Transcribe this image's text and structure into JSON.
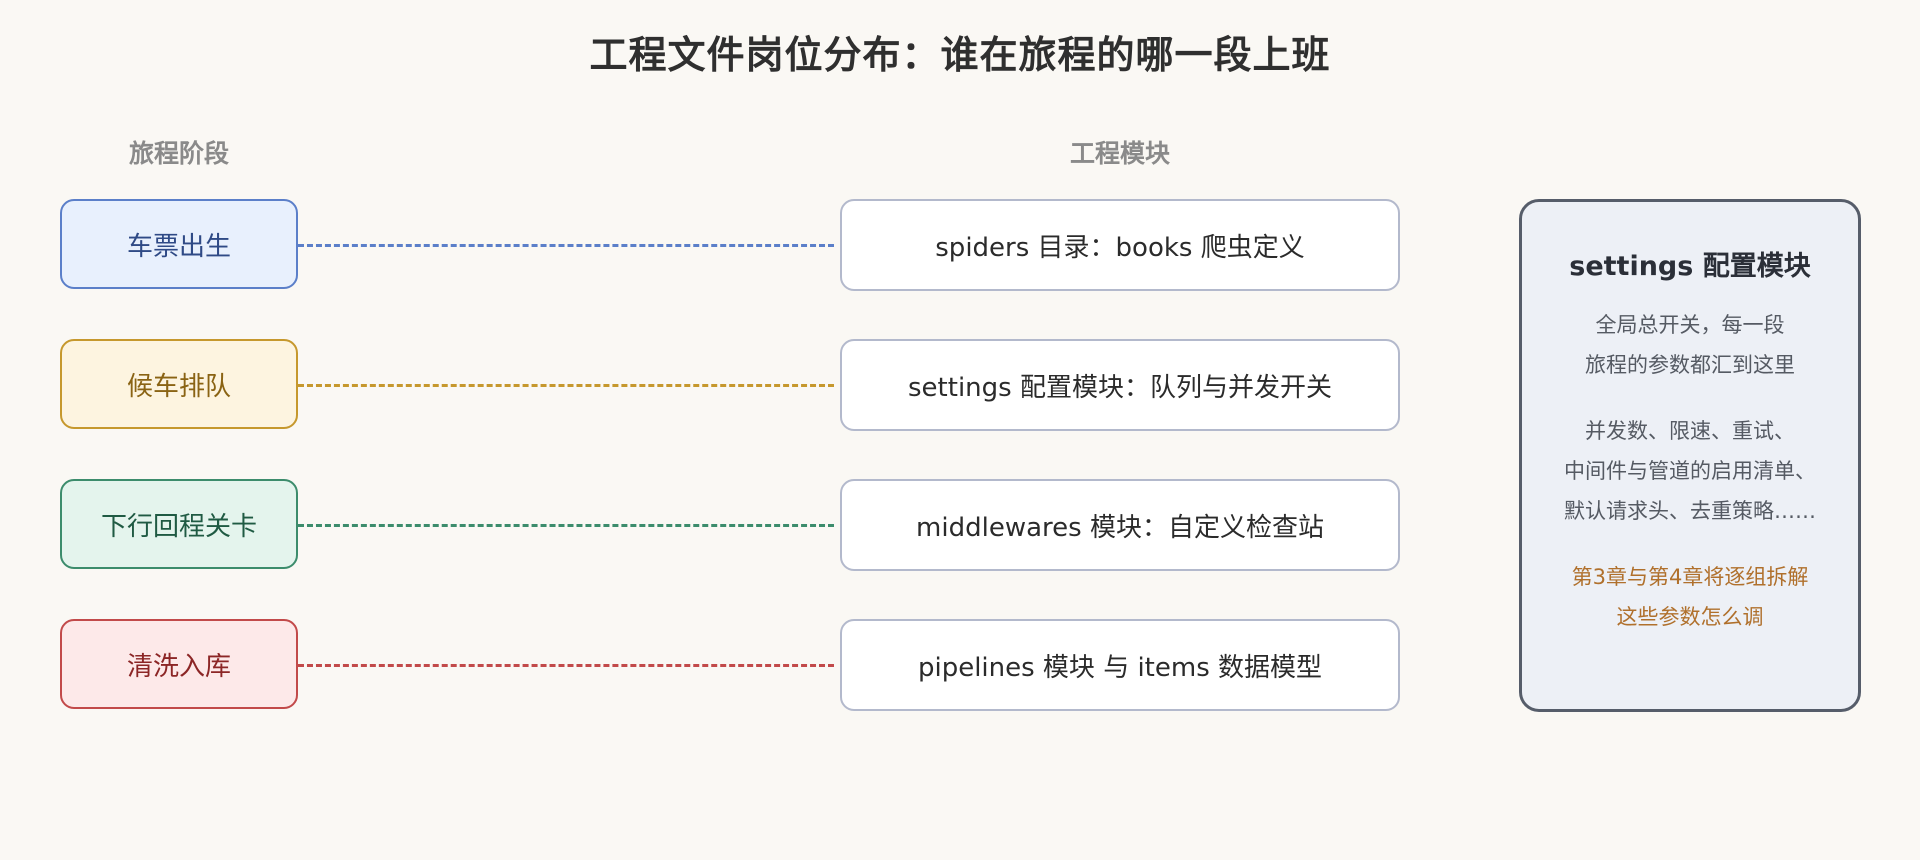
{
  "title": "工程文件岗位分布：谁在旅程的哪一段上班",
  "headers": {
    "stages": "旅程阶段",
    "modules": "工程模块"
  },
  "rows": [
    {
      "stage": "车票出生",
      "module": "spiders 目录：books 爬虫定义",
      "color": "#5b7fc9",
      "fill": "#e8f0fd",
      "text_color": "#2f4a86"
    },
    {
      "stage": "候车排队",
      "module": "settings 配置模块：队列与并发开关",
      "color": "#c6982d",
      "fill": "#fdf4e0",
      "text_color": "#8a6314"
    },
    {
      "stage": "下行回程关卡",
      "module": "middlewares 模块：自定义检查站",
      "color": "#3c8c6c",
      "fill": "#e4f4ed",
      "text_color": "#1f5a43"
    },
    {
      "stage": "清洗入库",
      "module": "pipelines 模块 与 items 数据模型",
      "color": "#c24a4a",
      "fill": "#fde9e9",
      "text_color": "#8c2626"
    }
  ],
  "side_card": {
    "title": "settings 配置模块",
    "para1": [
      "全局总开关，每一段",
      "旅程的参数都汇到这里"
    ],
    "para2": [
      "并发数、限速、重试、",
      "中间件与管道的启用清单、",
      "默认请求头、去重策略……"
    ],
    "para3": [
      "第3章与第4章将逐组拆解",
      "这些参数怎么调"
    ]
  },
  "colors": {
    "background": "#faf8f4",
    "module_border": "#b3b9cc",
    "side_border": "#565d6a",
    "side_fill": "#edf0f6",
    "side_accent": "#b0702c"
  }
}
